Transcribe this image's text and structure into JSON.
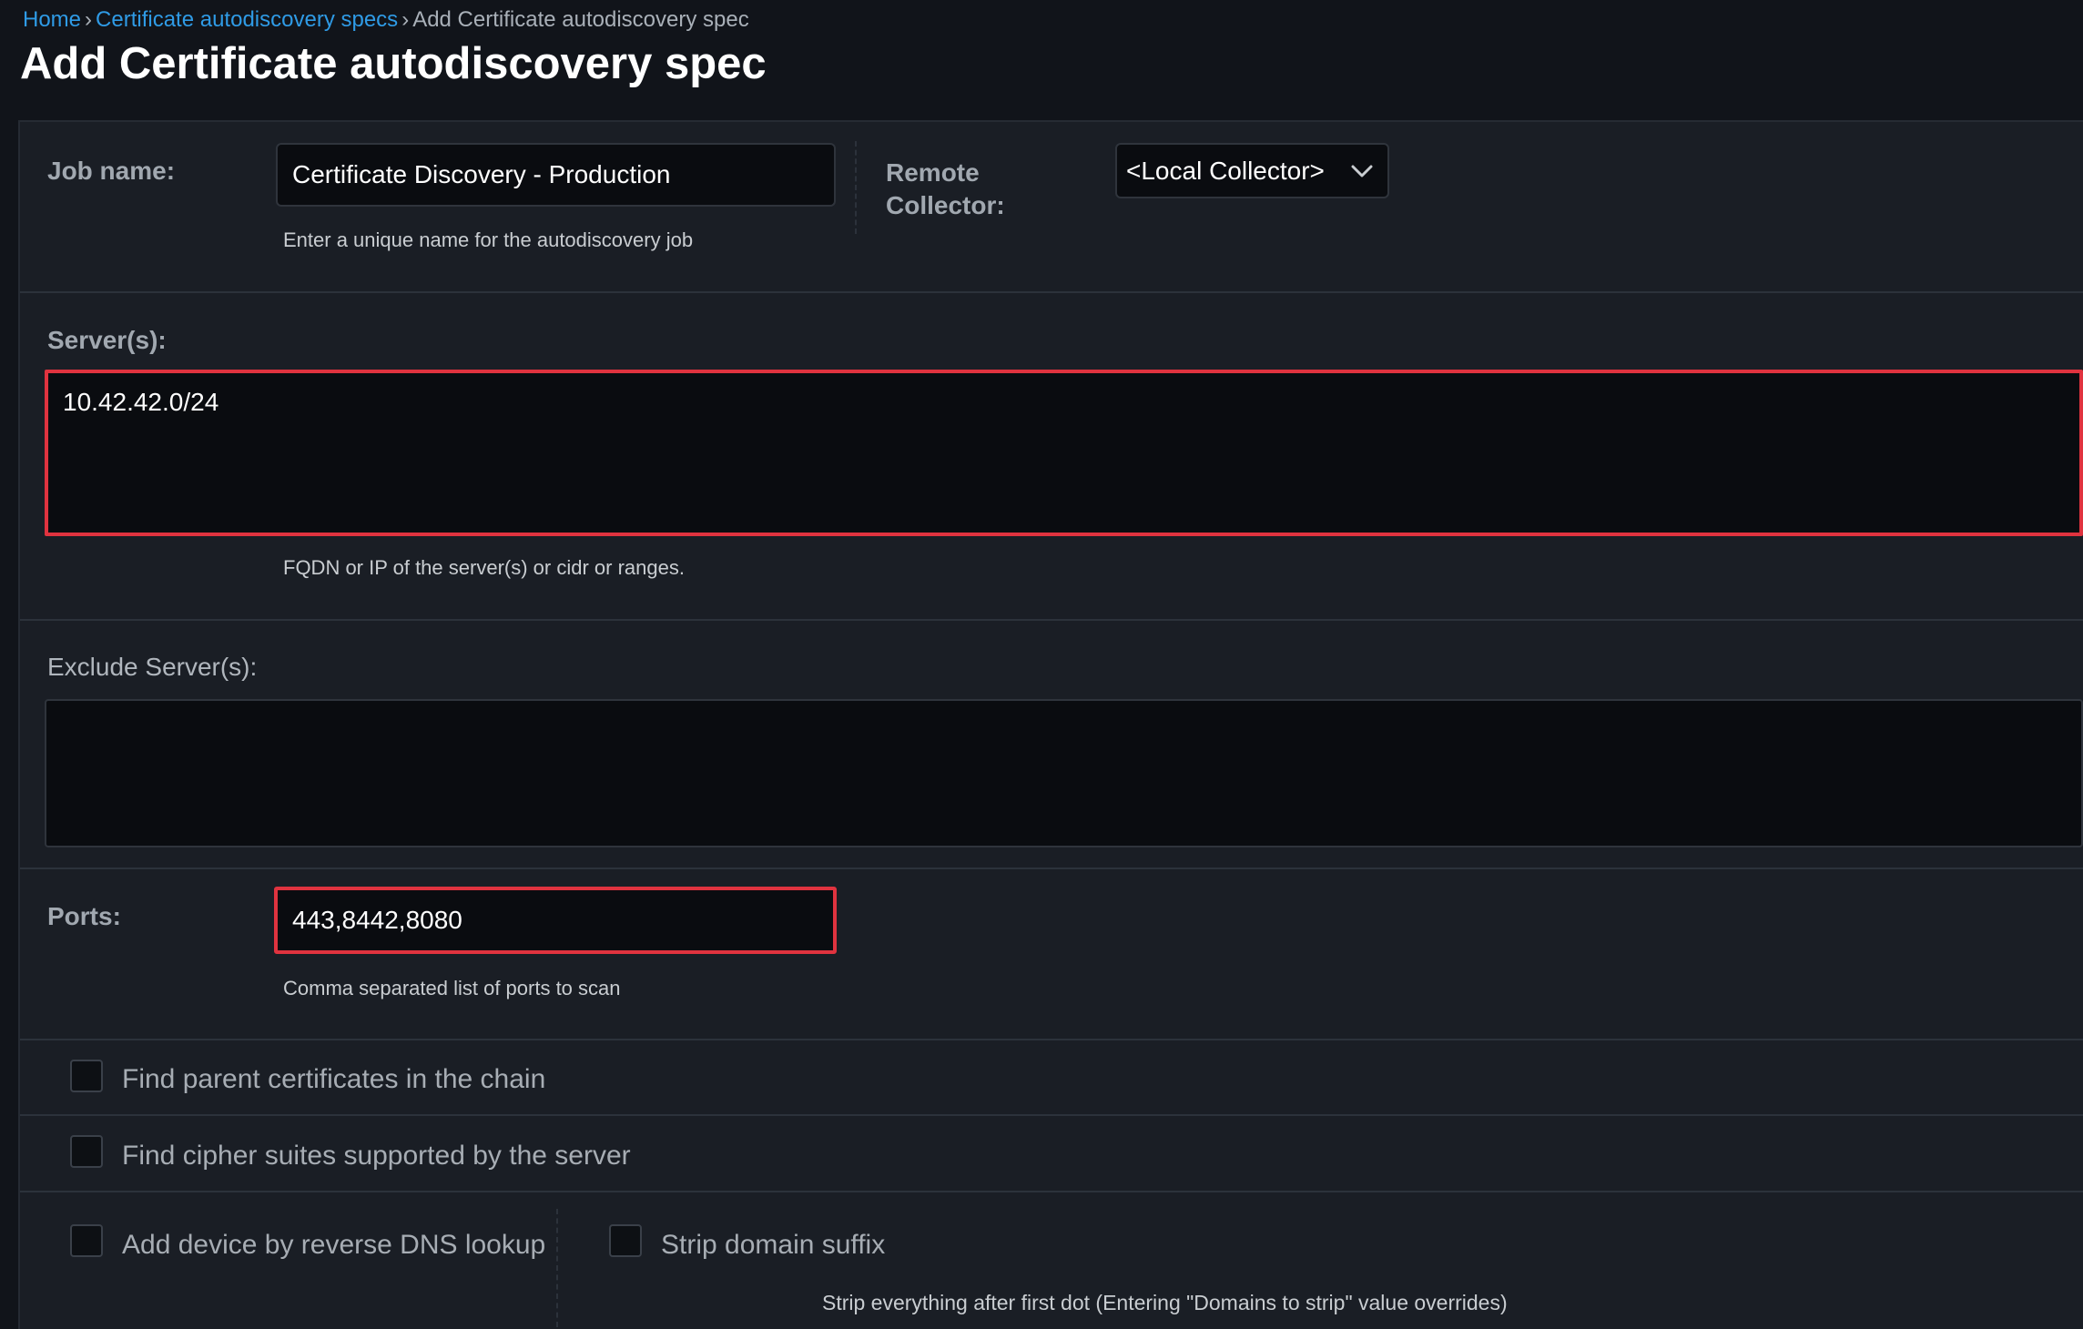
{
  "breadcrumb": {
    "home": "Home",
    "specs": "Certificate autodiscovery specs",
    "current": "Add Certificate autodiscovery spec",
    "separator": "›"
  },
  "page_title": "Add Certificate autodiscovery spec",
  "job_name": {
    "label": "Job name:",
    "value": "Certificate Discovery - Production",
    "help": "Enter a unique name for the autodiscovery job"
  },
  "remote_collector": {
    "label_line1": "Remote",
    "label_line2": "Collector:",
    "selected": "<Local Collector>",
    "icon": "chevron-down-icon"
  },
  "servers": {
    "label": "Server(s):",
    "value": "10.42.42.0/24",
    "help": "FQDN or IP of the server(s) or cidr or ranges."
  },
  "exclude_servers": {
    "label": "Exclude Server(s):",
    "value": ""
  },
  "ports": {
    "label": "Ports:",
    "value": "443,8442,8080",
    "help": "Comma separated list of ports to scan"
  },
  "options": {
    "find_parent": "Find parent certificates in the chain",
    "find_cipher": "Find cipher suites supported by the server",
    "reverse_dns": "Add device by reverse DNS lookup",
    "strip_domain": "Strip domain suffix",
    "strip_help": "Strip everything after first dot (Entering \"Domains to strip\" value overrides)"
  },
  "colors": {
    "background": "#11141a",
    "panel": "#1a1e25",
    "link": "#2f9be6",
    "highlight": "#e0333f",
    "input_bg": "#0a0c10"
  }
}
